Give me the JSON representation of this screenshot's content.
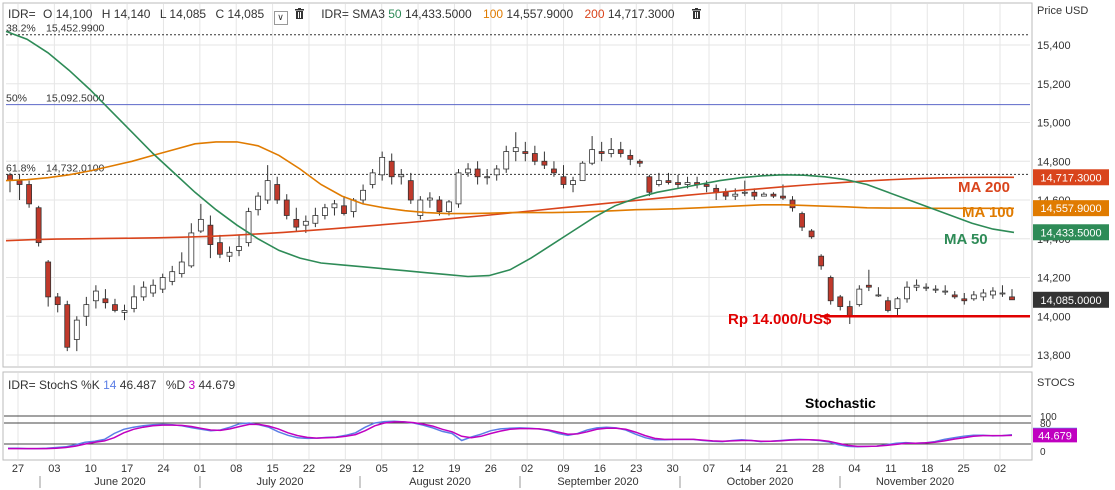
{
  "legend_top": {
    "symbol": "IDR=",
    "open_label": "O",
    "open": "14,100",
    "high_label": "H",
    "high": "14,140",
    "low_label": "L",
    "low": "14,085",
    "close_label": "C",
    "close": "14,085",
    "sma_label": "IDR= SMA3",
    "sma_a_period": "50",
    "sma_a_value": "14,433.5000",
    "sma_b_period": "100",
    "sma_b_value": "14,557.9000",
    "sma_c_period": "200",
    "sma_c_value": "14,717.3000"
  },
  "legend_bottom": {
    "label": "IDR= StochS %K",
    "k_period": "14",
    "k_value": "46.487",
    "d_label": "%D",
    "d_period": "3",
    "d_value": "44.679"
  },
  "colors": {
    "candle_up": "#ffffff",
    "candle_down": "#c0392b",
    "wick": "#333333",
    "ma50": "#2e8b57",
    "ma100": "#e07b00",
    "ma200": "#d9441c",
    "fib": "#5b67c8",
    "stoch_k": "#5b7ee5",
    "stoch_d": "#c000c0",
    "support": "#e00000",
    "grid": "#e6e6e6"
  },
  "chart_data": [
    {
      "type": "candlestick",
      "title": "",
      "ylabel": "Price USD",
      "ylim": [
        13750,
        15600
      ],
      "yticks": [
        "13,800",
        "14,000",
        "14,200",
        "14,400",
        "14,600",
        "14,800",
        "15,000",
        "15,200",
        "15,400"
      ],
      "x_day_ticks": [
        "27",
        "03",
        "10",
        "17",
        "24",
        "01",
        "08",
        "15",
        "22",
        "29",
        "05",
        "12",
        "19",
        "26",
        "02",
        "09",
        "16",
        "23",
        "30",
        "07",
        "14",
        "21",
        "28",
        "04",
        "11",
        "18",
        "25",
        "02"
      ],
      "x_month_labels": [
        "June 2020",
        "July 2020",
        "August 2020",
        "September 2020",
        "October 2020",
        "November 2020"
      ],
      "candles_ohlc": [
        [
          14730,
          14740,
          14640,
          14700
        ],
        [
          14700,
          14730,
          14600,
          14680
        ],
        [
          14680,
          14700,
          14560,
          14580
        ],
        [
          14560,
          14570,
          14360,
          14380
        ],
        [
          14280,
          14290,
          14050,
          14100
        ],
        [
          14100,
          14120,
          14020,
          14060
        ],
        [
          14060,
          14080,
          13820,
          13840
        ],
        [
          13880,
          14000,
          13820,
          13980
        ],
        [
          14000,
          14100,
          13950,
          14060
        ],
        [
          14080,
          14160,
          14040,
          14130
        ],
        [
          14090,
          14140,
          14040,
          14070
        ],
        [
          14060,
          14090,
          14020,
          14030
        ],
        [
          14020,
          14060,
          13980,
          14030
        ],
        [
          14040,
          14160,
          14020,
          14100
        ],
        [
          14100,
          14180,
          14080,
          14150
        ],
        [
          14120,
          14190,
          14100,
          14160
        ],
        [
          14140,
          14220,
          14120,
          14200
        ],
        [
          14180,
          14260,
          14160,
          14230
        ],
        [
          14220,
          14330,
          14200,
          14280
        ],
        [
          14260,
          14480,
          14250,
          14430
        ],
        [
          14440,
          14580,
          14430,
          14500
        ],
        [
          14470,
          14520,
          14300,
          14370
        ],
        [
          14380,
          14420,
          14300,
          14320
        ],
        [
          14310,
          14360,
          14280,
          14330
        ],
        [
          14340,
          14420,
          14310,
          14360
        ],
        [
          14380,
          14560,
          14360,
          14540
        ],
        [
          14550,
          14640,
          14520,
          14620
        ],
        [
          14600,
          14780,
          14580,
          14700
        ],
        [
          14680,
          14720,
          14580,
          14600
        ],
        [
          14600,
          14630,
          14500,
          14520
        ],
        [
          14500,
          14560,
          14440,
          14460
        ],
        [
          14470,
          14520,
          14430,
          14490
        ],
        [
          14480,
          14560,
          14460,
          14520
        ],
        [
          14520,
          14580,
          14500,
          14560
        ],
        [
          14560,
          14600,
          14520,
          14580
        ],
        [
          14570,
          14620,
          14520,
          14530
        ],
        [
          14540,
          14610,
          14510,
          14600
        ],
        [
          14600,
          14680,
          14580,
          14650
        ],
        [
          14680,
          14760,
          14660,
          14740
        ],
        [
          14730,
          14850,
          14700,
          14820
        ],
        [
          14800,
          14840,
          14680,
          14720
        ],
        [
          14720,
          14760,
          14680,
          14730
        ],
        [
          14700,
          14740,
          14580,
          14600
        ],
        [
          14520,
          14620,
          14500,
          14600
        ],
        [
          14600,
          14640,
          14560,
          14610
        ],
        [
          14600,
          14620,
          14520,
          14540
        ],
        [
          14540,
          14600,
          14520,
          14590
        ],
        [
          14580,
          14760,
          14560,
          14740
        ],
        [
          14740,
          14790,
          14720,
          14760
        ],
        [
          14760,
          14800,
          14680,
          14720
        ],
        [
          14720,
          14760,
          14680,
          14720
        ],
        [
          14730,
          14780,
          14700,
          14760
        ],
        [
          14760,
          14880,
          14740,
          14850
        ],
        [
          14850,
          14950,
          14800,
          14870
        ],
        [
          14850,
          14900,
          14800,
          14840
        ],
        [
          14840,
          14880,
          14780,
          14800
        ],
        [
          14800,
          14850,
          14760,
          14780
        ],
        [
          14760,
          14800,
          14720,
          14740
        ],
        [
          14720,
          14780,
          14660,
          14680
        ],
        [
          14680,
          14720,
          14640,
          14700
        ],
        [
          14700,
          14800,
          14700,
          14790
        ],
        [
          14790,
          14930,
          14780,
          14860
        ],
        [
          14850,
          14900,
          14800,
          14840
        ],
        [
          14840,
          14920,
          14820,
          14860
        ],
        [
          14860,
          14900,
          14820,
          14840
        ],
        [
          14830,
          14860,
          14780,
          14810
        ],
        [
          14800,
          14810,
          14770,
          14790
        ],
        [
          14720,
          14730,
          14620,
          14640
        ],
        [
          14680,
          14740,
          14670,
          14700
        ],
        [
          14700,
          14740,
          14680,
          14690
        ],
        [
          14690,
          14730,
          14660,
          14680
        ],
        [
          14680,
          14720,
          14660,
          14690
        ],
        [
          14690,
          14720,
          14660,
          14680
        ],
        [
          14680,
          14700,
          14640,
          14670
        ],
        [
          14660,
          14680,
          14600,
          14640
        ],
        [
          14640,
          14660,
          14600,
          14620
        ],
        [
          14620,
          14660,
          14600,
          14630
        ],
        [
          14640,
          14700,
          14620,
          14640
        ],
        [
          14640,
          14660,
          14600,
          14620
        ],
        [
          14620,
          14640,
          14620,
          14630
        ],
        [
          14630,
          14640,
          14610,
          14620
        ],
        [
          14620,
          14680,
          14600,
          14610
        ],
        [
          14600,
          14620,
          14540,
          14560
        ],
        [
          14530,
          14540,
          14440,
          14460
        ],
        [
          14440,
          14450,
          14400,
          14410
        ],
        [
          14310,
          14320,
          14240,
          14260
        ],
        [
          14200,
          14210,
          14060,
          14080
        ],
        [
          14100,
          14110,
          14030,
          14050
        ],
        [
          14050,
          14080,
          13960,
          14000
        ],
        [
          14060,
          14160,
          14050,
          14140
        ],
        [
          14160,
          14240,
          14130,
          14150
        ],
        [
          14110,
          14150,
          14100,
          14110
        ],
        [
          14080,
          14100,
          14020,
          14030
        ],
        [
          14040,
          14100,
          14000,
          14090
        ],
        [
          14090,
          14180,
          14070,
          14150
        ],
        [
          14150,
          14190,
          14130,
          14160
        ],
        [
          14150,
          14170,
          14130,
          14150
        ],
        [
          14140,
          14160,
          14120,
          14140
        ],
        [
          14130,
          14160,
          14110,
          14130
        ],
        [
          14110,
          14130,
          14090,
          14100
        ],
        [
          14090,
          14120,
          14060,
          14080
        ],
        [
          14090,
          14130,
          14080,
          14110
        ],
        [
          14100,
          14140,
          14080,
          14120
        ],
        [
          14110,
          14150,
          14090,
          14130
        ],
        [
          14120,
          14160,
          14100,
          14120
        ],
        [
          14100,
          14140,
          14085,
          14085
        ]
      ],
      "ma50_values": [
        15470,
        15430,
        15360,
        15270,
        15170,
        15060,
        14950,
        14840,
        14740,
        14640,
        14550,
        14470,
        14400,
        14340,
        14300,
        14275,
        14265,
        14255,
        14245,
        14235,
        14225,
        14215,
        14205,
        14210,
        14240,
        14300,
        14370,
        14440,
        14510,
        14570,
        14610,
        14640,
        14660,
        14680,
        14700,
        14715,
        14725,
        14730,
        14728,
        14720,
        14705,
        14680,
        14640,
        14600,
        14560,
        14520,
        14480,
        14450,
        14433
      ],
      "ma100_values": [
        14700,
        14705,
        14715,
        14730,
        14750,
        14775,
        14800,
        14830,
        14860,
        14890,
        14900,
        14900,
        14880,
        14830,
        14760,
        14680,
        14620,
        14580,
        14560,
        14545,
        14535,
        14530,
        14530,
        14532,
        14535,
        14535,
        14535,
        14537,
        14540,
        14545,
        14550,
        14552,
        14555,
        14560,
        14565,
        14570,
        14575,
        14575,
        14572,
        14568,
        14565,
        14560,
        14558,
        14558,
        14557,
        14557,
        14557,
        14557,
        14557
      ],
      "ma200_values": [
        14390,
        14395,
        14398,
        14400,
        14402,
        14403,
        14405,
        14408,
        14412,
        14418,
        14425,
        14433,
        14442,
        14452,
        14462,
        14473,
        14484,
        14496,
        14508,
        14520,
        14533,
        14546,
        14559,
        14572,
        14585,
        14598,
        14611,
        14624,
        14636,
        14648,
        14659,
        14670,
        14680,
        14689,
        14697,
        14704,
        14710,
        14714,
        14716,
        14717,
        14717.3
      ],
      "fib_levels": [
        {
          "label": "38.2%",
          "value": 15452.99,
          "text": "15,452.9900",
          "style": "dotted"
        },
        {
          "label": "50%",
          "value": 15092.5,
          "text": "15,092.5000",
          "style": "solid"
        },
        {
          "label": "61.8%",
          "value": 14732.01,
          "text": "14,732.0100",
          "style": "dotted"
        }
      ],
      "price_tags": [
        "14,717.3000",
        "14,557.9000",
        "14,433.5000",
        "14,085.0000"
      ],
      "annotations": [
        {
          "text": "MA 200",
          "color": "#d9441c"
        },
        {
          "text": "MA 100",
          "color": "#e07b00"
        },
        {
          "text": "MA 50",
          "color": "#2e8b57"
        },
        {
          "text": "Rp 14.000/US$",
          "value": 14000,
          "color": "#e00000"
        }
      ]
    },
    {
      "type": "line",
      "title": "Stochastic",
      "ylabel": "STOCS",
      "ylim": [
        -5,
        110
      ],
      "yticks": [
        "0",
        "80",
        "100"
      ],
      "reference_lines": [
        20,
        80,
        100
      ],
      "series": [
        {
          "name": "%K",
          "values": [
            8,
            8,
            7,
            7,
            8,
            10,
            12,
            18,
            25,
            28,
            33,
            50,
            62,
            68,
            72,
            75,
            76,
            75,
            72,
            67,
            62,
            58,
            60,
            68,
            78,
            80,
            75,
            68,
            55,
            45,
            38,
            36,
            37,
            39,
            40,
            45,
            52,
            68,
            80,
            84,
            85,
            83,
            80,
            74,
            66,
            56,
            50,
            30,
            40,
            48,
            58,
            63,
            65,
            66,
            65,
            63,
            58,
            50,
            45,
            50,
            60,
            66,
            68,
            66,
            60,
            48,
            38,
            32,
            32,
            33,
            33,
            33,
            30,
            28,
            27,
            30,
            32,
            30,
            27,
            28,
            30,
            32,
            33,
            32,
            30,
            26,
            18,
            13,
            12,
            13,
            14,
            18,
            22,
            24,
            22,
            23,
            27,
            33,
            38,
            42,
            45,
            45,
            43,
            44,
            46.487
          ]
        },
        {
          "name": "%D",
          "values": [
            7,
            7,
            7,
            7,
            7,
            8,
            10,
            14,
            20,
            25,
            29,
            38,
            52,
            62,
            68,
            72,
            74,
            74,
            73,
            70,
            65,
            60,
            59,
            63,
            70,
            76,
            76,
            71,
            63,
            52,
            44,
            39,
            37,
            38,
            39,
            42,
            47,
            58,
            72,
            80,
            83,
            83,
            81,
            77,
            71,
            62,
            55,
            42,
            38,
            42,
            50,
            57,
            62,
            64,
            64,
            63,
            60,
            54,
            48,
            49,
            55,
            62,
            65,
            65,
            62,
            54,
            44,
            36,
            33,
            33,
            33,
            33,
            31,
            29,
            28,
            29,
            30,
            30,
            28,
            28,
            29,
            31,
            32,
            32,
            31,
            28,
            22,
            16,
            13,
            13,
            14,
            16,
            19,
            22,
            22,
            23,
            25,
            29,
            34,
            38,
            42,
            44,
            44,
            44,
            44.679
          ]
        }
      ]
    }
  ]
}
